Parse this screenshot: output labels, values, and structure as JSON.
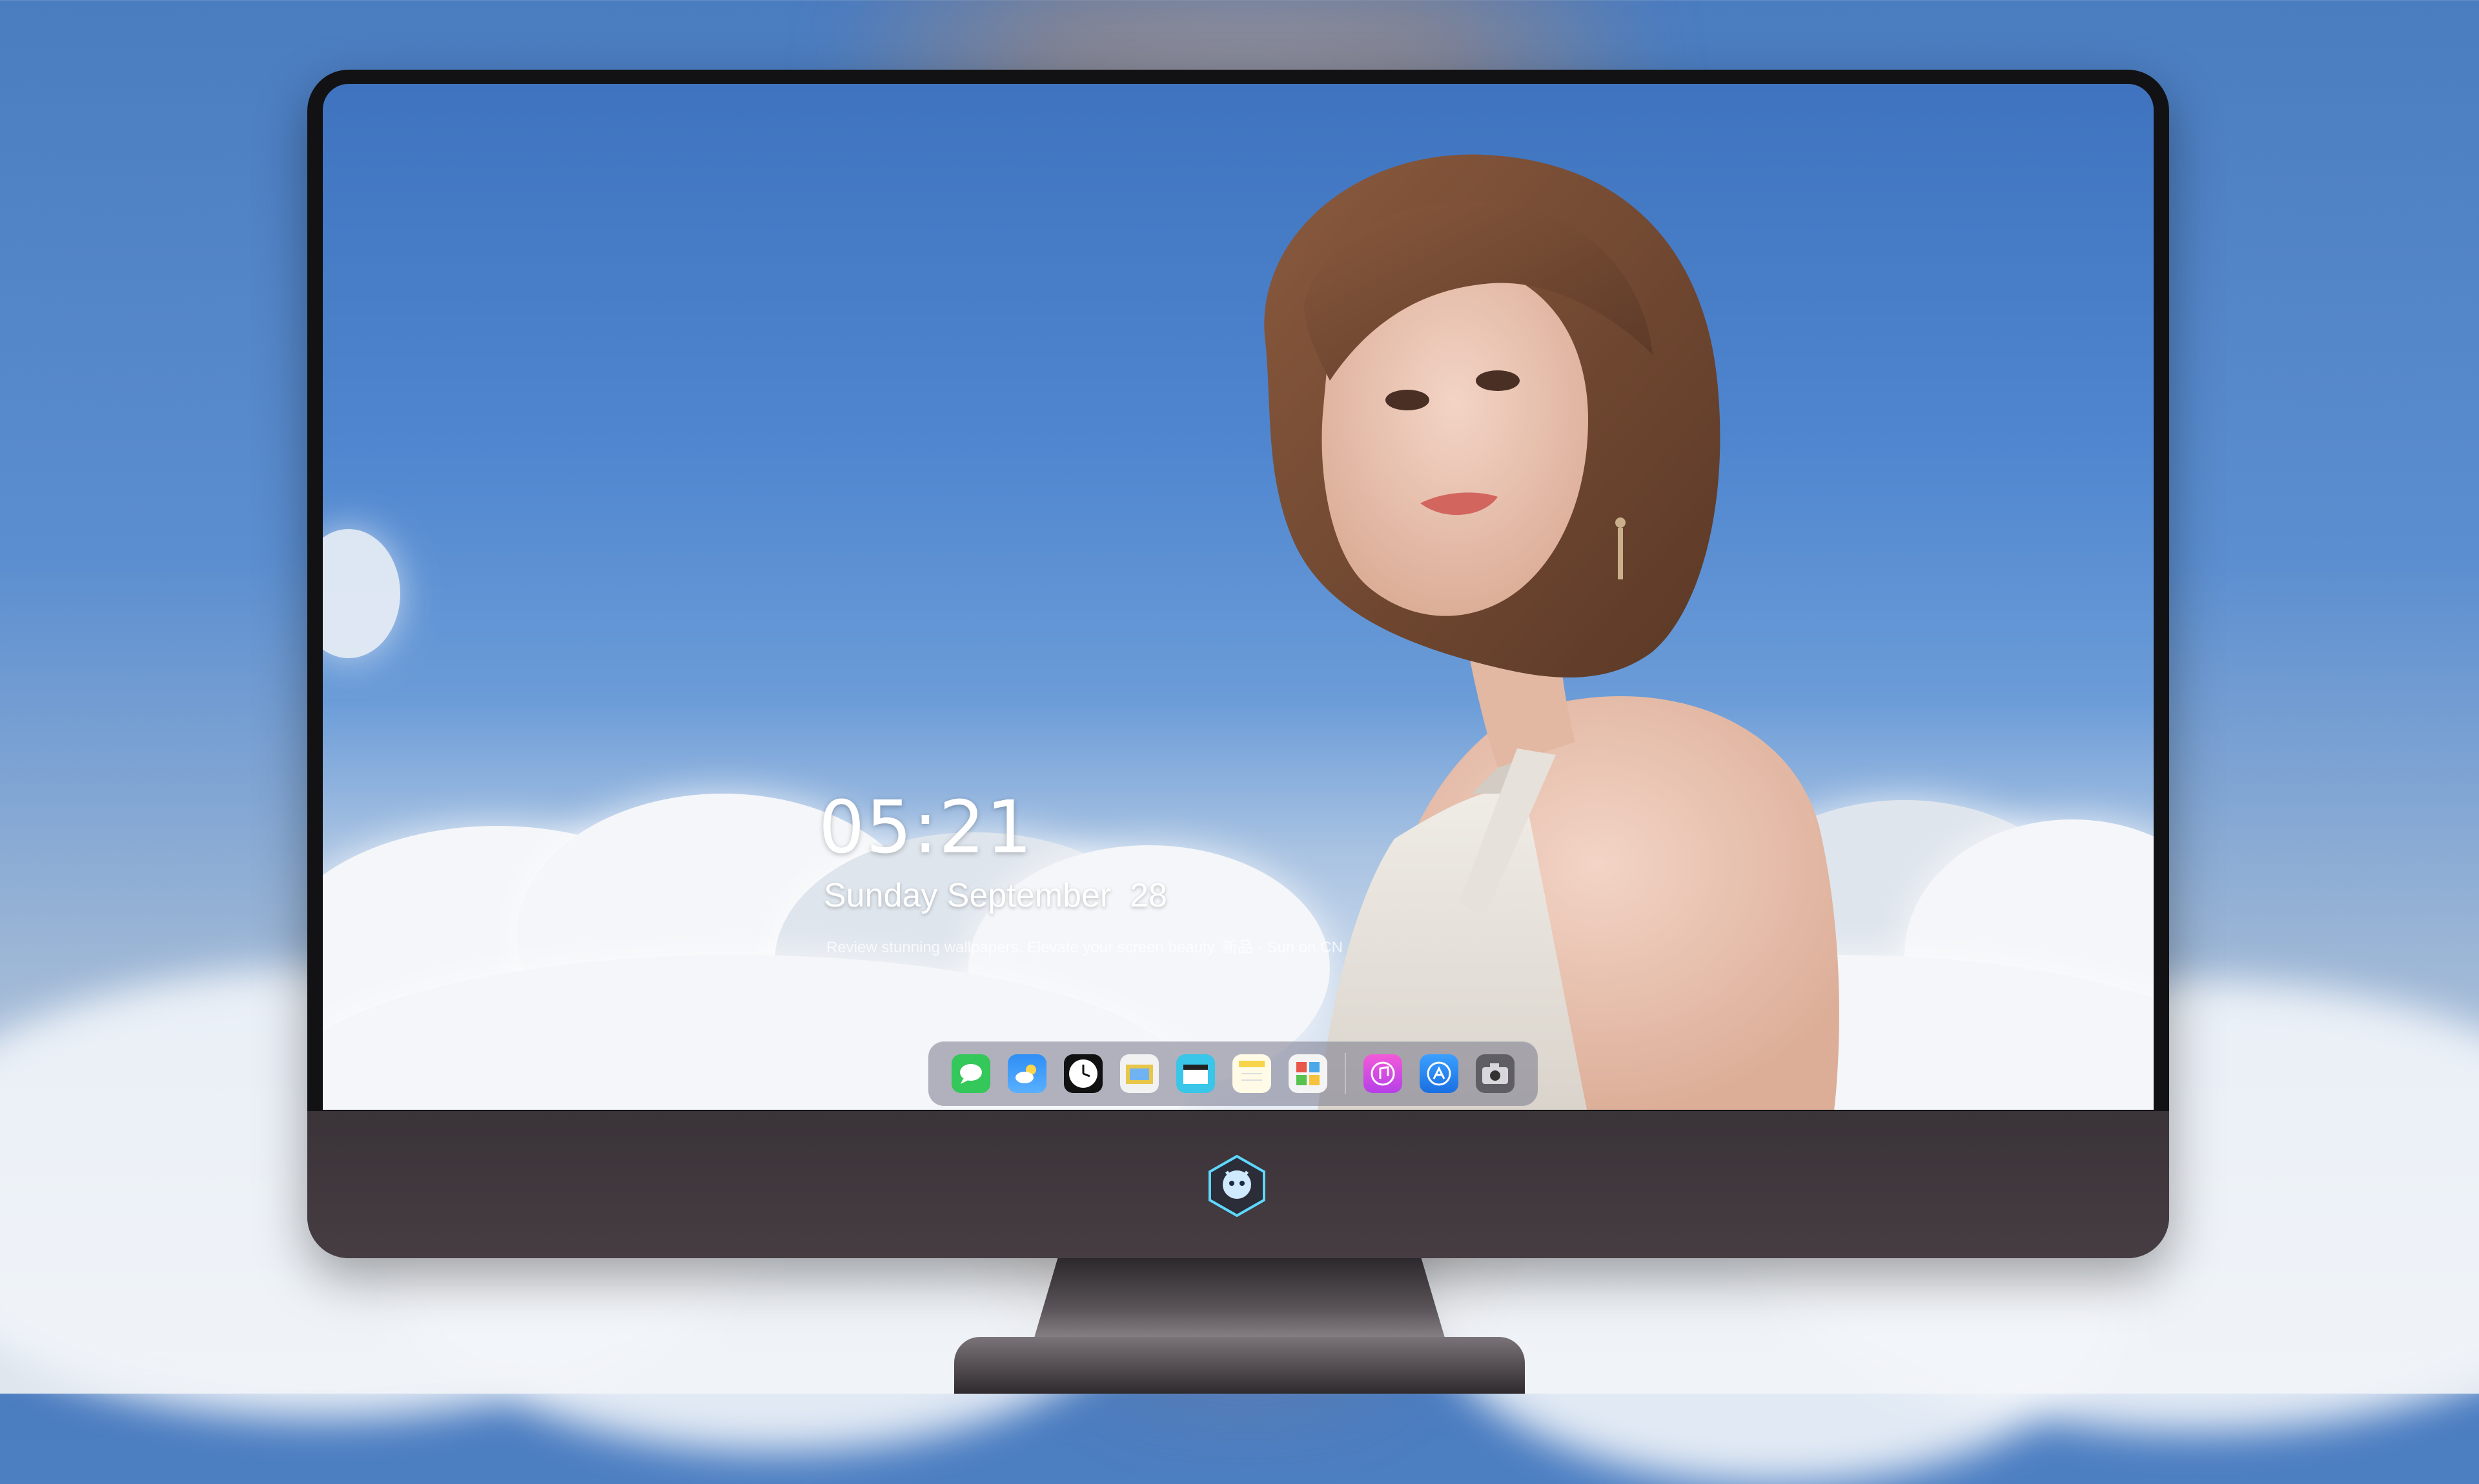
{
  "lock_screen": {
    "time": "05:21",
    "date": "Sunday September  28",
    "tagline": "Review stunning wallpapers. Elevate your screen beauty. 新品 · Sun on CN"
  },
  "dock": {
    "apps": [
      {
        "name": "Messages",
        "icon": "messages-icon",
        "color": "#34c759"
      },
      {
        "name": "Weather",
        "icon": "weather-icon",
        "color": "#2f8ef5"
      },
      {
        "name": "Clock",
        "icon": "clock-icon",
        "color": "#111111"
      },
      {
        "name": "Preview",
        "icon": "preview-icon",
        "color": "#e8c64a"
      },
      {
        "name": "Clips",
        "icon": "clips-icon",
        "color": "#39c6e8"
      },
      {
        "name": "Notes",
        "icon": "notes-icon",
        "color": "#f7d449"
      },
      {
        "name": "Photo Booth",
        "icon": "photo-booth-icon",
        "color": "#e8574a"
      },
      {
        "name": "Music",
        "icon": "music-icon",
        "color": "#e04fd6"
      },
      {
        "name": "App Store",
        "icon": "app-store-icon",
        "color": "#1e8ef5"
      },
      {
        "name": "Camera",
        "icon": "camera-icon",
        "color": "#6f6f75"
      }
    ]
  },
  "colors": {
    "sky": "#4f86cf",
    "bezel": "#121214",
    "chin": "#3f383d"
  }
}
